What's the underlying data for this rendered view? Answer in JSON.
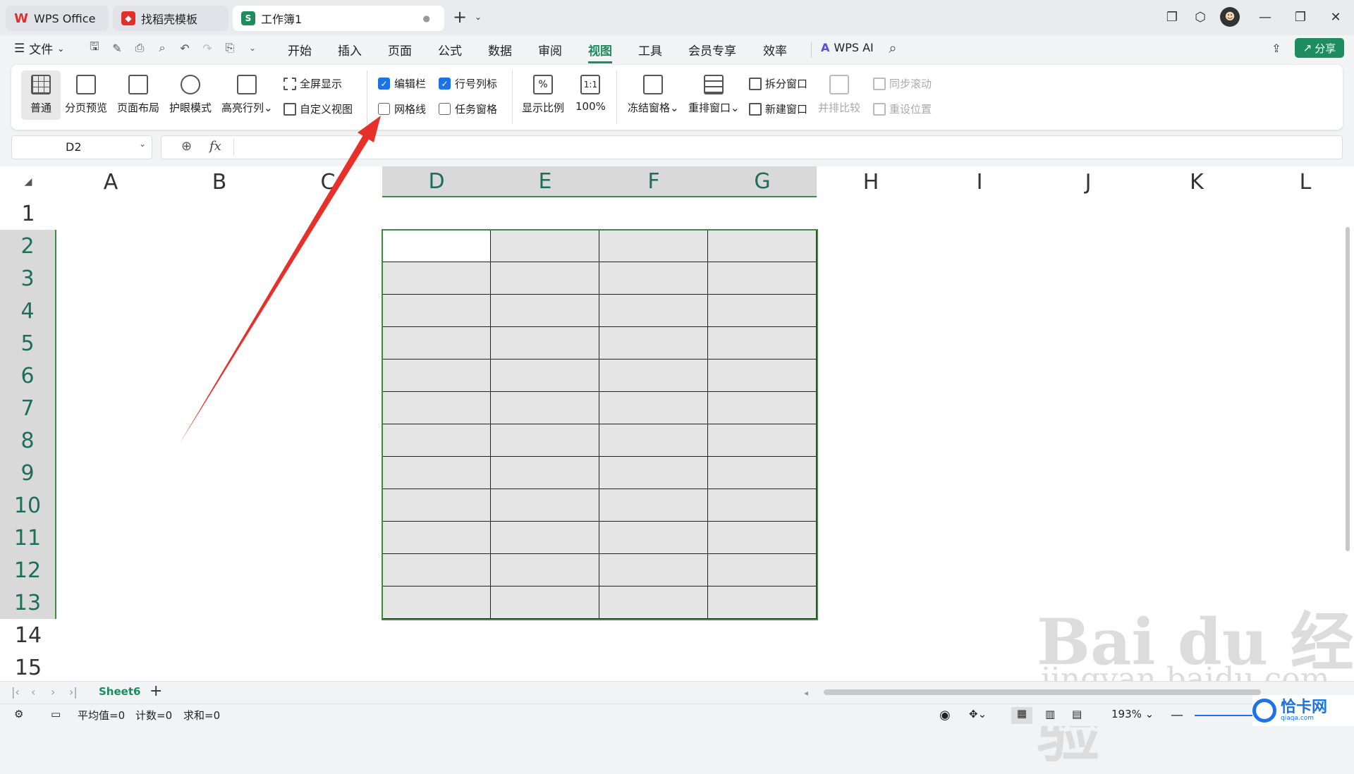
{
  "tabs": [
    {
      "label": "WPS Office"
    },
    {
      "label": "找稻壳模板"
    },
    {
      "label": "工作簿1"
    }
  ],
  "menu": {
    "file_label": "文件",
    "items": [
      "开始",
      "插入",
      "页面",
      "公式",
      "数据",
      "审阅",
      "视图",
      "工具",
      "会员专享",
      "效率"
    ],
    "active": "视图",
    "ai_label": "WPS AI",
    "share_label": "分享"
  },
  "ribbon": {
    "normal": "普通",
    "page_break_preview": "分页预览",
    "page_layout": "页面布局",
    "eye_protection": "护眼模式",
    "highlight_rowcol": "高亮行列",
    "fullscreen": "全屏显示",
    "custom_view": "自定义视图",
    "formula_bar": "编辑栏",
    "row_col_headers": "行号列标",
    "gridlines": "网格线",
    "task_pane": "任务窗格",
    "zoom": "显示比例",
    "zoom_100": "100%",
    "freeze_panes": "冻结窗格",
    "arrange": "重排窗口",
    "split": "拆分窗口",
    "new_window": "新建窗口",
    "side_by_side": "并排比较",
    "sync_scroll": "同步滚动",
    "reset_position": "重设位置"
  },
  "checkboxes": {
    "formula_bar": true,
    "row_col_headers": true,
    "gridlines": false,
    "task_pane": false
  },
  "formula": {
    "name_box": "D2",
    "fx": "fx",
    "content": ""
  },
  "columns": [
    "A",
    "B",
    "C",
    "D",
    "E",
    "F",
    "G",
    "H",
    "I",
    "J",
    "K",
    "L"
  ],
  "selected_columns": [
    "D",
    "E",
    "F",
    "G"
  ],
  "rows": [
    "1",
    "2",
    "3",
    "4",
    "5",
    "6",
    "7",
    "8",
    "9",
    "10",
    "11",
    "12",
    "13",
    "14",
    "15"
  ],
  "selected_rows": [
    "2",
    "3",
    "4",
    "5",
    "6",
    "7",
    "8",
    "9",
    "10",
    "11",
    "12",
    "13"
  ],
  "sheet_tab": "Sheet6",
  "status": {
    "average": "平均值=0",
    "count": "计数=0",
    "sum": "求和=0",
    "zoom": "193%"
  },
  "watermark": {
    "brand": "Bai du 经验",
    "url": "jingyan.baidu.com",
    "corner": "恰卡网",
    "corner_url": "qiaqa.com"
  },
  "colors": {
    "accent": "#1a73e8",
    "active_tab": "#1d8c5f",
    "selection": "#3d8b3d",
    "arrow": "#e8302a"
  }
}
